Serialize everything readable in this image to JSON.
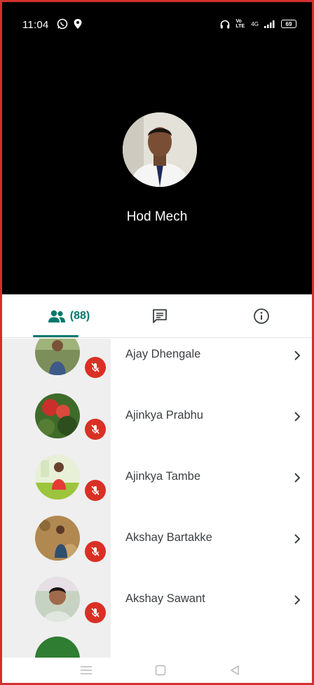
{
  "status_bar": {
    "time": "11:04",
    "network_label": "Vo LTE",
    "signal_label": "4G",
    "battery": "69"
  },
  "speaker": {
    "name": "Hod Mech"
  },
  "tabs": {
    "people_count": "(88)",
    "active": "people"
  },
  "participants": [
    {
      "name": "Ajay Dhengale",
      "muted": true
    },
    {
      "name": "Ajinkya Prabhu",
      "muted": true
    },
    {
      "name": "Ajinkya Tambe",
      "muted": true
    },
    {
      "name": "Akshay Bartakke",
      "muted": true
    },
    {
      "name": "Akshay Sawant",
      "muted": true
    }
  ],
  "colors": {
    "accent": "#00796b",
    "mute_red": "#d93025",
    "frame_red": "#d32f2f"
  }
}
